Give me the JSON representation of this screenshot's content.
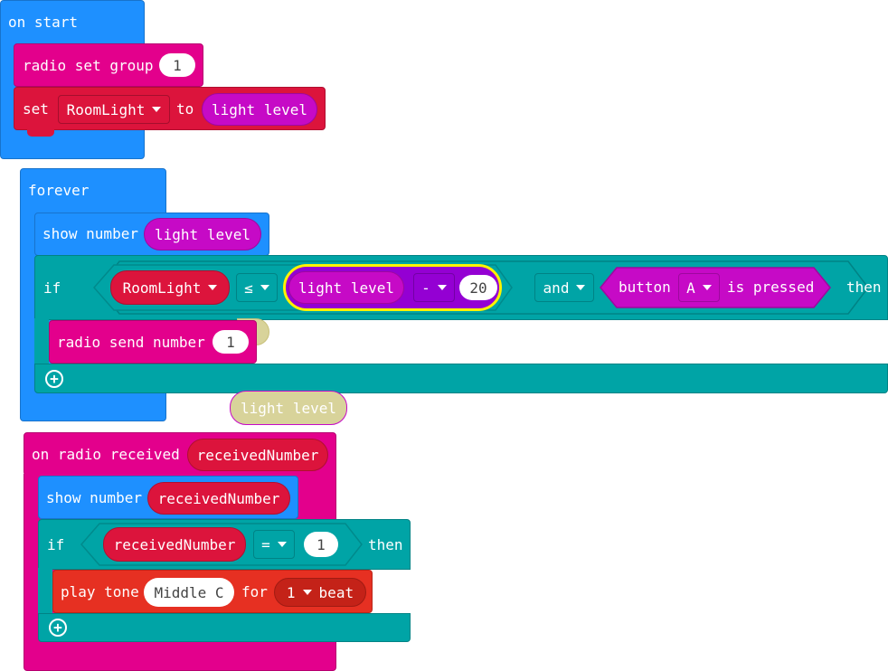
{
  "colors": {
    "events_blue": "#1e90ff",
    "radio_pink": "#e3008c",
    "variable_red": "#dc143c",
    "logic_teal": "#00a4a6",
    "input_purple": "#c60ac6",
    "math_purple": "#9400d3",
    "music_red": "#e63022",
    "highlight_yellow": "#fff200"
  },
  "on_start": {
    "header": "on start",
    "radio_set_group": {
      "label": "radio set group",
      "value": "1"
    },
    "set_var": {
      "label_set": "set",
      "variable": "RoomLight",
      "label_to": "to",
      "value": "light level"
    }
  },
  "forever": {
    "header": "forever",
    "show_number": {
      "label": "show number",
      "value": "light level"
    },
    "if_block": {
      "label_if": "if",
      "left_var": "RoomLight",
      "compare_op": "≤",
      "math_left": "light level",
      "math_op": "-",
      "math_right": "20",
      "logic_op": "and",
      "button_label": "button",
      "button_name": "A",
      "button_state": "is pressed",
      "label_then": "then",
      "body": {
        "label": "radio send number",
        "value": "1"
      }
    },
    "detached_block": "light level"
  },
  "on_radio_received": {
    "header": "on radio received",
    "param": "receivedNumber",
    "show_number": {
      "label": "show number",
      "value": "receivedNumber"
    },
    "if_block": {
      "label_if": "if",
      "left_var": "receivedNumber",
      "compare_op": "=",
      "right_value": "1",
      "label_then": "then",
      "play_tone": {
        "label_play": "play tone",
        "note": "Middle C",
        "label_for": "for",
        "beats": "1",
        "label_beat": "beat"
      }
    }
  }
}
